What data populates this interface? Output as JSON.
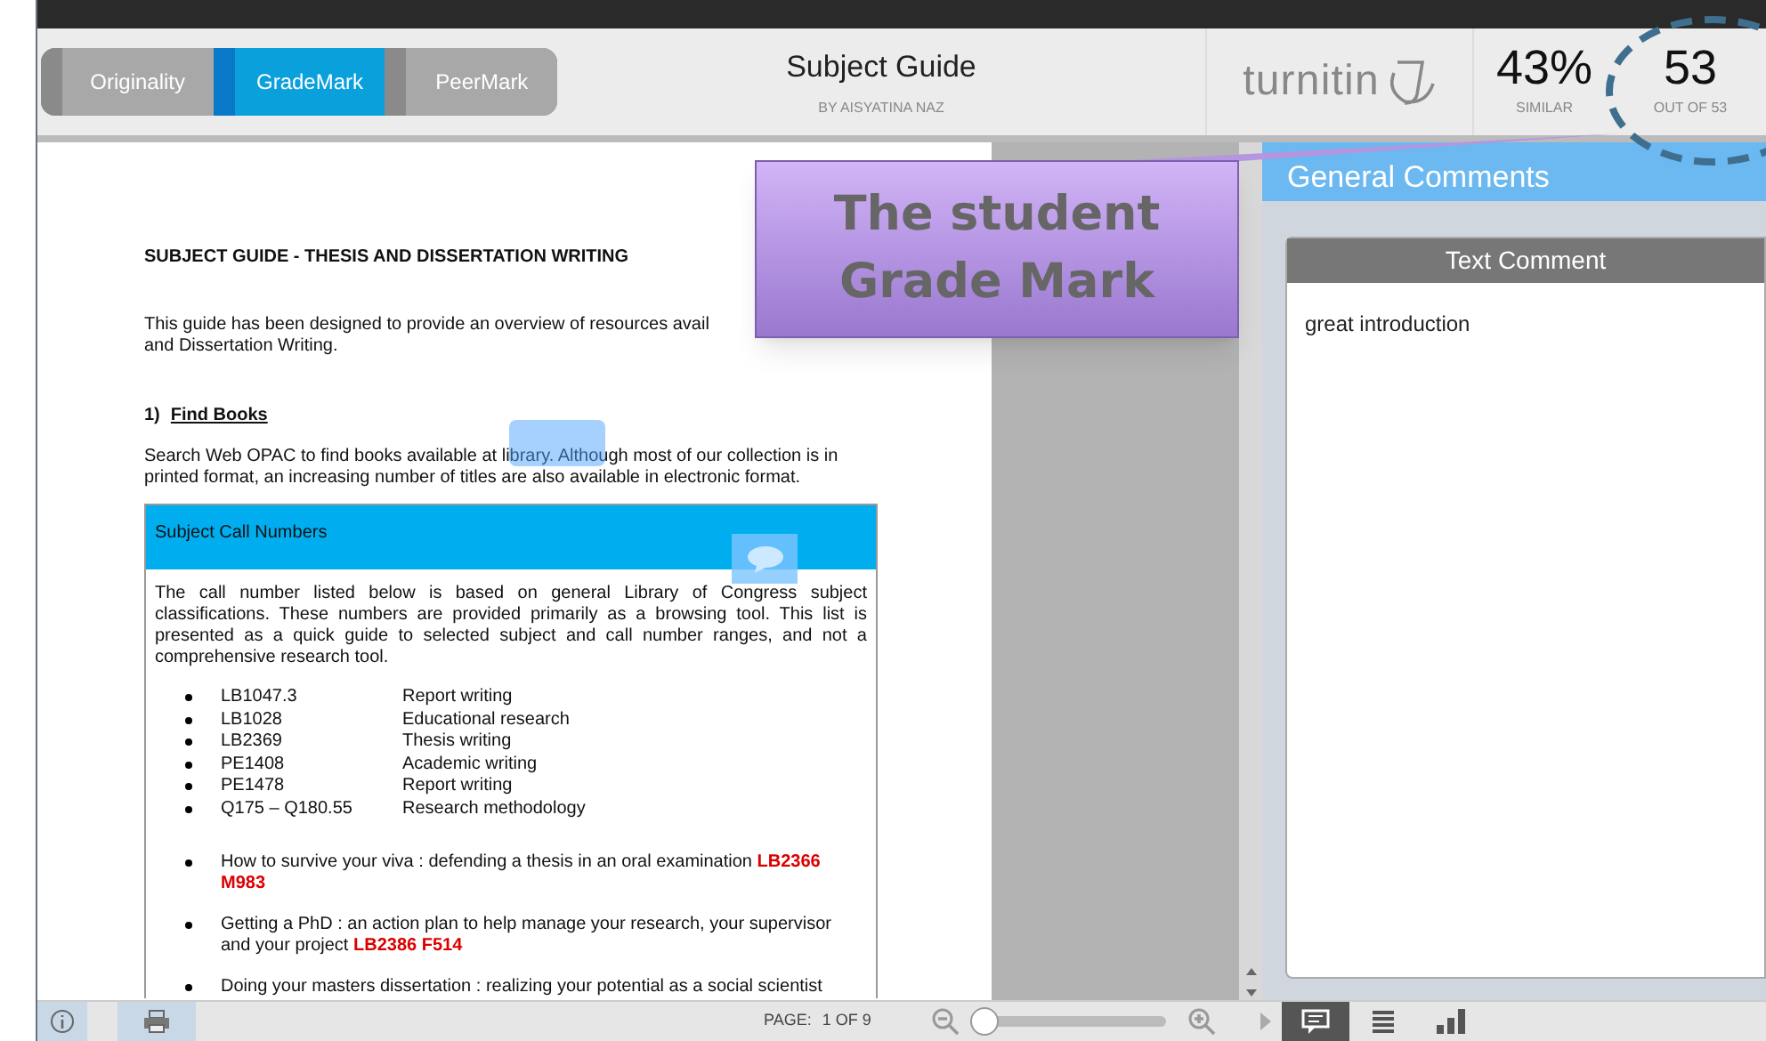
{
  "tabs": [
    {
      "label": "Originality",
      "selected": false
    },
    {
      "label": "GradeMark",
      "selected": true
    },
    {
      "label": "PeerMark",
      "selected": false
    }
  ],
  "document": {
    "title": "Subject Guide",
    "author": "BY AISYATINA NAZ"
  },
  "logo": {
    "text": "turnitin"
  },
  "similarity": {
    "value": "43%",
    "label": "SIMILAR"
  },
  "grade": {
    "value": "53",
    "label": "OUT OF 53"
  },
  "page": {
    "heading": "SUBJECT GUIDE - THESIS AND DISSERTATION WRITING",
    "intro": [
      "This guide has been designed to provide an overview of resources avail",
      "and Dissertation Writing."
    ],
    "section_number": "1)",
    "section_title": "Find Books",
    "section_text": "Search Web OPAC to find books available at library. Although most of our collection is in printed format, an increasing number of titles are also available in electronic format.",
    "box_title": "Subject Call Numbers",
    "box_text": "The call number listed below is based on general Library of Congress subject classifications. These numbers are provided primarily as a browsing tool. This list is presented as a quick guide to selected subject and call number ranges, and not a comprehensive research tool.",
    "call_numbers": [
      {
        "code": "LB1047.3",
        "subject": "Report writing"
      },
      {
        "code": "LB1028",
        "subject": "Educational research"
      },
      {
        "code": "LB2369",
        "subject": "Thesis writing"
      },
      {
        "code": "PE1408",
        "subject": "Academic writing"
      },
      {
        "code": "PE1478",
        "subject": "Report writing"
      },
      {
        "code": "Q175 – Q180.55",
        "subject": "Research methodology"
      }
    ],
    "books": [
      "How to survive your viva : defending a thesis in an oral examination **LB2366 M983**",
      "Getting a PhD : an action plan to help manage your research, your supervisor and your project **LB2386 F514**",
      "Doing your masters dissertation : realizing your potential as a social scientist"
    ]
  },
  "comments_panel": {
    "header": "General Comments",
    "section": "Text Comment",
    "comment": "great introduction"
  },
  "callout": {
    "text": "The student Grade Mark"
  },
  "footer": {
    "page_label": "PAGE:",
    "page_value": "1 OF 9",
    "zoom": {
      "level": 0.0
    }
  },
  "view_tabs": [
    {
      "kind": "comments",
      "selected": true
    },
    {
      "kind": "list",
      "selected": false
    },
    {
      "kind": "grid",
      "selected": false
    }
  ]
}
